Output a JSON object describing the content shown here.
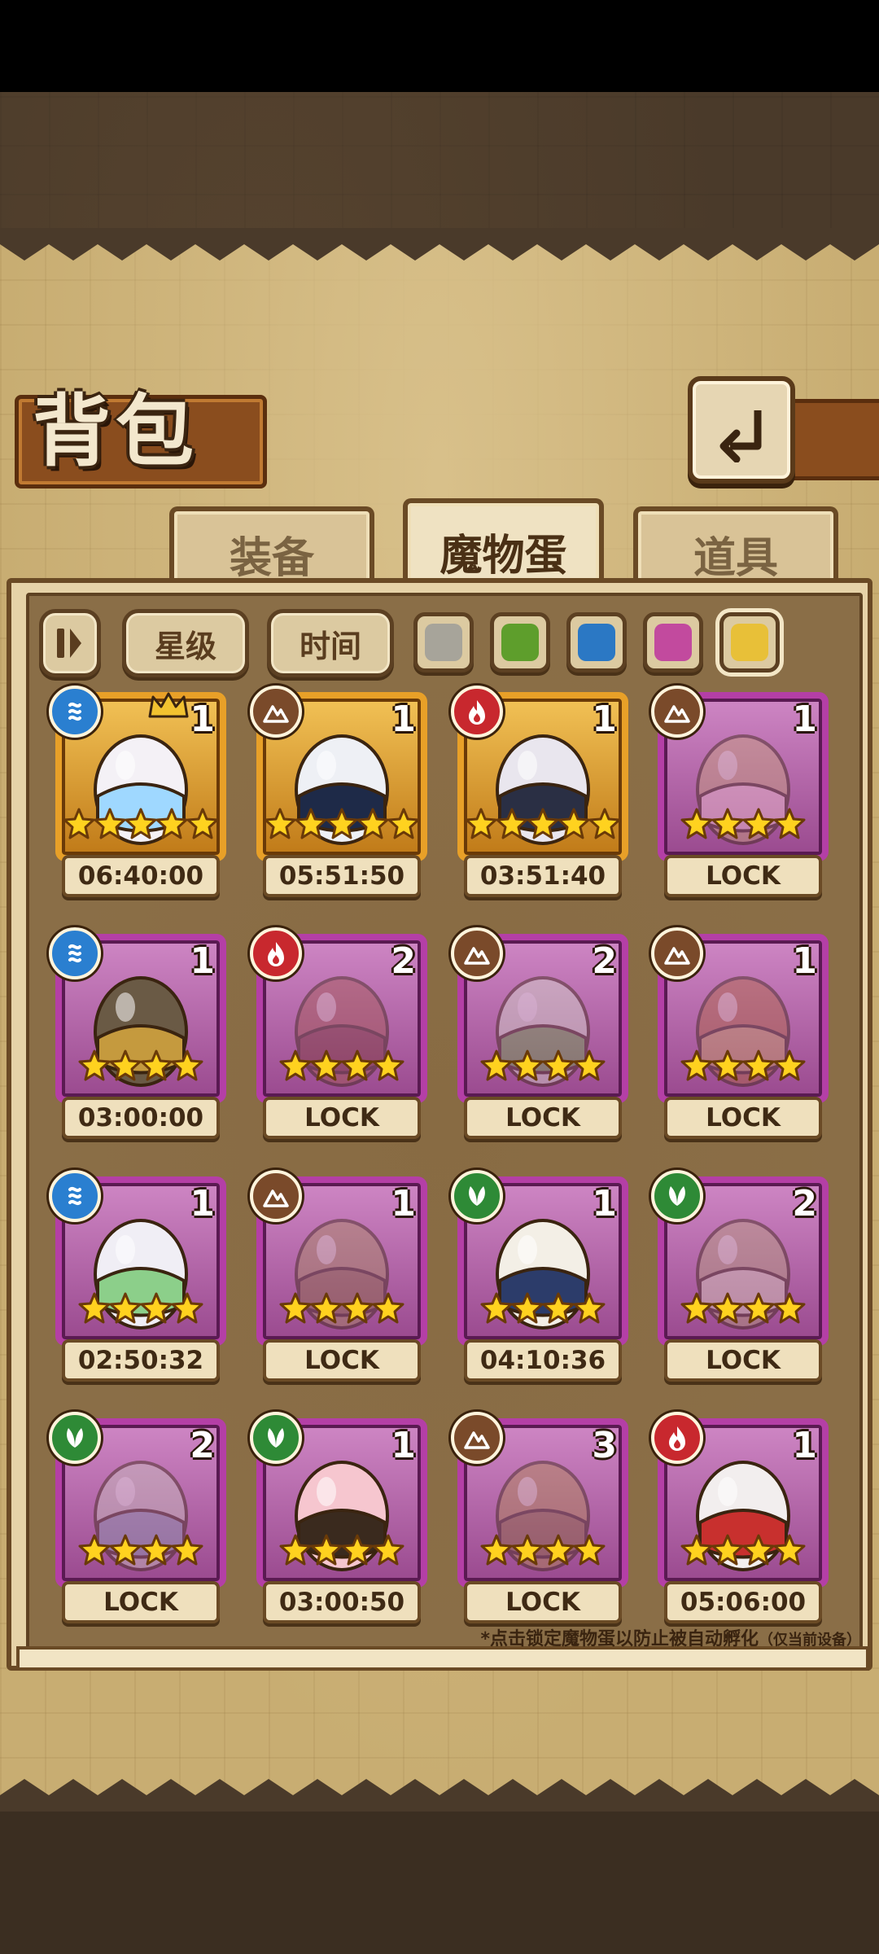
{
  "header": {
    "title": "背包"
  },
  "tabs": [
    {
      "label": "装备",
      "active": false
    },
    {
      "label": "魔物蛋",
      "active": true
    },
    {
      "label": "道具",
      "active": false
    }
  ],
  "filters": {
    "sort_star": "星级",
    "sort_time": "时间",
    "colors": [
      {
        "name": "gray",
        "hex": "#a7a49a"
      },
      {
        "name": "green",
        "hex": "#5e9e2c"
      },
      {
        "name": "blue",
        "hex": "#2b78c4"
      },
      {
        "name": "pink",
        "hex": "#c24a9e"
      },
      {
        "name": "yellow",
        "hex": "#e8c038",
        "selected": true
      }
    ]
  },
  "eggs": [
    {
      "element": "water",
      "count": "1",
      "stars": 5,
      "frame": "gold",
      "timer": "06:40:00",
      "crowned": true,
      "locked": false
    },
    {
      "element": "earth",
      "count": "1",
      "stars": 5,
      "frame": "gold",
      "timer": "05:51:50",
      "locked": false
    },
    {
      "element": "fire",
      "count": "1",
      "stars": 5,
      "frame": "gold",
      "timer": "03:51:40",
      "locked": false
    },
    {
      "element": "earth",
      "count": "1",
      "stars": 4,
      "frame": "purple",
      "timer": "LOCK",
      "locked": true
    },
    {
      "element": "water",
      "count": "1",
      "stars": 4,
      "frame": "purple",
      "timer": "03:00:00",
      "locked": false
    },
    {
      "element": "fire",
      "count": "2",
      "stars": 4,
      "frame": "purple",
      "timer": "LOCK",
      "locked": true
    },
    {
      "element": "earth",
      "count": "2",
      "stars": 4,
      "frame": "purple",
      "timer": "LOCK",
      "locked": true
    },
    {
      "element": "earth",
      "count": "1",
      "stars": 4,
      "frame": "purple",
      "timer": "LOCK",
      "locked": true
    },
    {
      "element": "water",
      "count": "1",
      "stars": 4,
      "frame": "purple",
      "timer": "02:50:32",
      "locked": false
    },
    {
      "element": "earth",
      "count": "1",
      "stars": 4,
      "frame": "purple",
      "timer": "LOCK",
      "locked": true
    },
    {
      "element": "grass",
      "count": "1",
      "stars": 4,
      "frame": "purple",
      "timer": "04:10:36",
      "locked": false
    },
    {
      "element": "grass",
      "count": "2",
      "stars": 4,
      "frame": "purple",
      "timer": "LOCK",
      "locked": true
    },
    {
      "element": "grass",
      "count": "2",
      "stars": 4,
      "frame": "purple",
      "timer": "LOCK",
      "locked": true
    },
    {
      "element": "grass",
      "count": "1",
      "stars": 4,
      "frame": "purple",
      "timer": "03:00:50",
      "locked": false
    },
    {
      "element": "earth",
      "count": "3",
      "stars": 4,
      "frame": "purple",
      "timer": "LOCK",
      "locked": true
    },
    {
      "element": "fire",
      "count": "1",
      "stars": 4,
      "frame": "purple",
      "timer": "05:06:00",
      "locked": false
    }
  ],
  "footnote": {
    "main": "*点击锁定魔物蛋以防止被自动孵化",
    "sub": "（仅当前设备）"
  }
}
